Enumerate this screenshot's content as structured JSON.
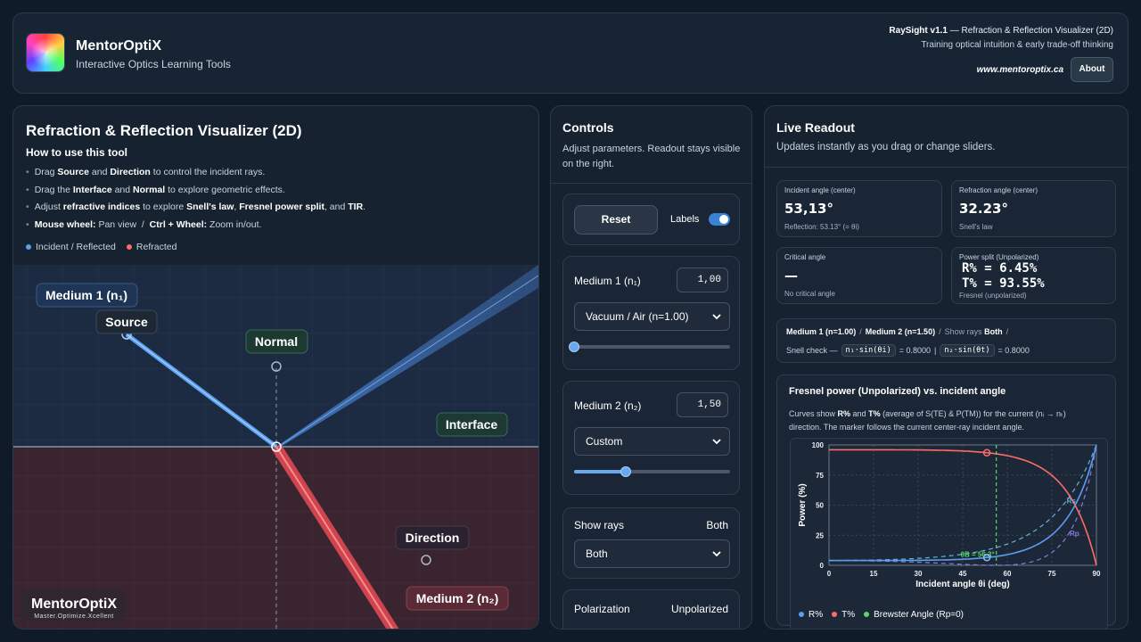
{
  "header": {
    "brand": "MentorOptiX",
    "tagline": "Interactive Optics Learning Tools",
    "app_name": "RaySight v1.1",
    "app_desc": " — Refraction & Reflection Visualizer (2D)",
    "app_sub": "Training optical intuition & early trade-off thinking",
    "url": "www.mentoroptix.ca",
    "about_label": "About"
  },
  "viz": {
    "title": "Refraction & Reflection Visualizer (2D)",
    "howto_title": "How to use this tool",
    "legend_incident": "Incident / Reflected",
    "legend_refracted": "Refracted",
    "labels": {
      "medium1": "Medium 1 (n₁)",
      "source": "Source",
      "normal": "Normal",
      "interface": "Interface",
      "direction": "Direction",
      "medium2": "Medium 2 (n₂)"
    },
    "watermark": "MentorOptiX",
    "watermark_sub": "Master.Optimize.Xcellent"
  },
  "controls": {
    "title": "Controls",
    "subtitle": "Adjust parameters. Readout stays visible on the right.",
    "reset_label": "Reset",
    "labels_toggle": "Labels",
    "labels_on": true,
    "medium1": {
      "label": "Medium 1 (n₁)",
      "value": "1,00",
      "preset": "Vacuum / Air (n=1.00)",
      "slider_fraction": 0.0
    },
    "medium2": {
      "label": "Medium 2 (n₂)",
      "value": "1,50",
      "preset": "Custom",
      "slider_fraction": 0.33
    },
    "show_rays": {
      "label": "Show rays",
      "value": "Both",
      "selected": "Both"
    },
    "polarization": {
      "label": "Polarization",
      "value": "Unpolarized"
    }
  },
  "readout": {
    "title": "Live Readout",
    "subtitle": "Updates instantly as you drag or change sliders.",
    "incident": {
      "label": "Incident angle (center)",
      "value": "53,13°",
      "note": "Reflection: 53.13° (= θi)"
    },
    "refraction": {
      "label": "Refraction angle (center)",
      "value": "32.23°",
      "note": "Snell's law"
    },
    "critical": {
      "label": "Critical angle",
      "value": "—",
      "note": "No critical angle"
    },
    "power": {
      "label": "Power split (Unpolarized)",
      "r": "R% = 6.45%",
      "t": "T% = 93.55%",
      "note": "Fresnel (unpolarized)"
    },
    "snell": {
      "m1": "Medium 1 (n=1.00)",
      "sep": "/",
      "m2": "Medium 2 (n=1.50)",
      "rays_label": "Show rays",
      "rays_value": "Both",
      "check_label": "Snell check —",
      "expr1": "n₁·sin(θi)",
      "val1": "= 0.8000",
      "bar": "|",
      "expr2": "n₂·sin(θt)",
      "val2": "= 0.8000"
    },
    "fresnel": {
      "title": "Fresnel power (Unpolarized) vs. incident angle",
      "desc_a": "Curves show ",
      "desc_r": "R%",
      "desc_and": " and ",
      "desc_t": "T%",
      "desc_b": " (average of S(TE) & P(TM)) for the current (nᵢ → nₜ) direction. The marker follows the current center-ray incident angle.",
      "legend": [
        "R%",
        "T%",
        "Brewster Angle (Rp=0)"
      ]
    }
  },
  "colors": {
    "incident": "#5a9ef0",
    "refracted": "#ff6a6a",
    "brewster": "#5ad66a",
    "accent": "#3a82d8"
  },
  "chart_data": {
    "type": "line",
    "title": "",
    "xlabel": "Incident angle θi (deg)",
    "ylabel": "Power (%)",
    "xlim": [
      0,
      90
    ],
    "ylim": [
      0,
      100
    ],
    "xticks": [
      0,
      15,
      30,
      45,
      60,
      75,
      90
    ],
    "yticks": [
      0,
      25,
      50,
      75,
      100
    ],
    "grid": true,
    "n1": 1.0,
    "n2": 1.5,
    "marker_angle": 53.13,
    "brewster_angle": 56.3,
    "brewster_label": "θB = 56.3°",
    "series": [
      {
        "name": "R%",
        "style": "solid",
        "color": "#5a9ef0"
      },
      {
        "name": "T%",
        "style": "solid",
        "color": "#ff6a6a"
      },
      {
        "name": "Rs",
        "style": "dashed",
        "color": "#6ab0d8"
      },
      {
        "name": "Rp",
        "style": "dashed",
        "color": "#8a7ae0"
      }
    ],
    "legend_position": "bottom"
  }
}
